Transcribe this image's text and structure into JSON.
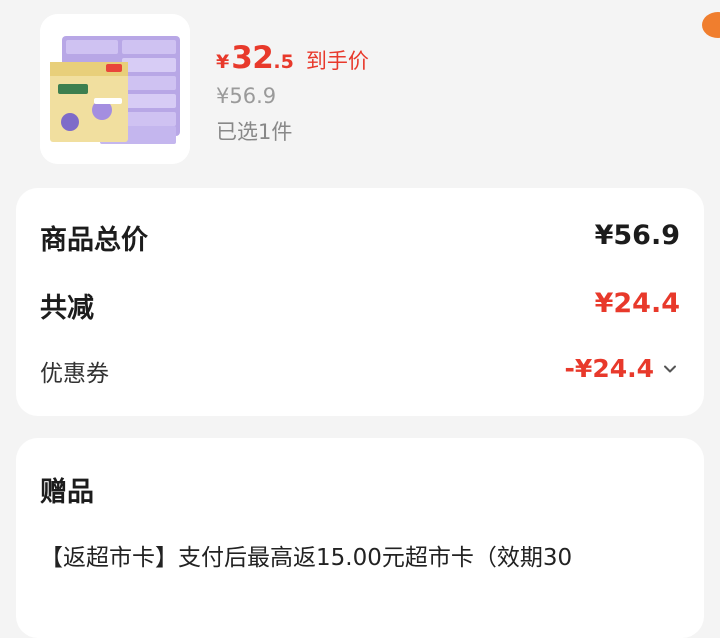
{
  "product": {
    "image_icon": "tissue-pack-image",
    "price_currency": "¥",
    "price_integer": "32",
    "price_decimal": ".5",
    "price_suffix": "到手价",
    "original_price": "¥56.9",
    "selected_count": "已选1件"
  },
  "summary": {
    "total_label": "商品总价",
    "total_value": "¥56.9",
    "reduce_label": "共减",
    "reduce_value": "¥24.4",
    "coupon_label": "优惠券",
    "coupon_value": "-¥24.4",
    "coupon_icon": "chevron-down-icon"
  },
  "gift": {
    "title": "赠品",
    "description": "【返超市卡】支付后最高返15.00元超市卡（效期30"
  },
  "colors": {
    "accent_red": "#e8392b",
    "page_bg": "#f4f4f4",
    "card_bg": "#ffffff",
    "corner_orange": "#f07e2e"
  }
}
